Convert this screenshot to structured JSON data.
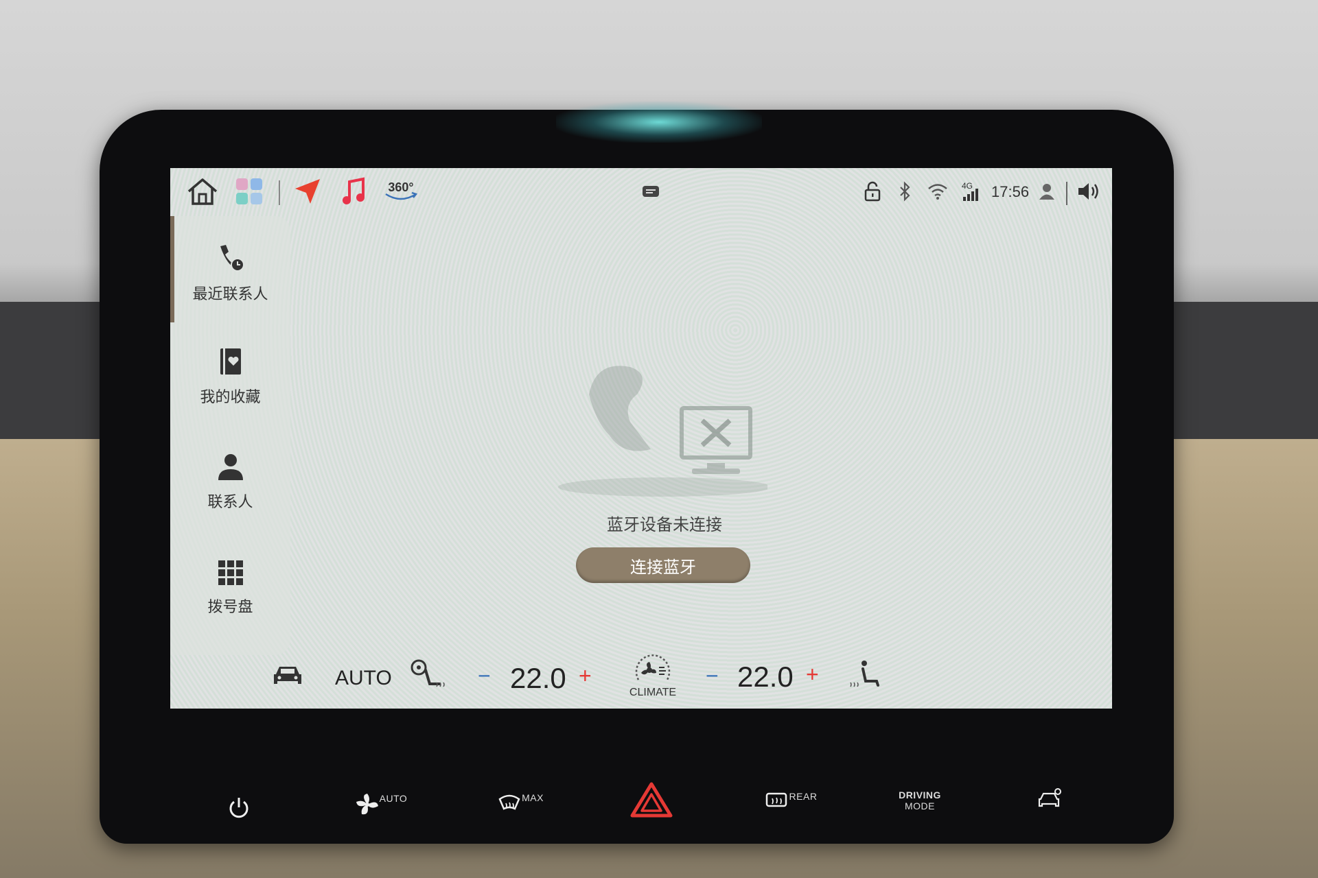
{
  "topbar": {
    "temp_icon_label": "360°",
    "time": "17:56",
    "network": "4G"
  },
  "sidebar": {
    "items": [
      {
        "label": "最近联系人",
        "icon": "phone-clock-icon"
      },
      {
        "label": "我的收藏",
        "icon": "favorites-book-icon"
      },
      {
        "label": "联系人",
        "icon": "person-icon"
      },
      {
        "label": "拨号盘",
        "icon": "dialpad-icon"
      }
    ]
  },
  "main": {
    "status_message": "蓝牙设备未连接",
    "connect_button_label": "连接蓝牙"
  },
  "climate": {
    "auto_label": "AUTO",
    "driver_minus": "−",
    "driver_temp": "22.0",
    "driver_plus": "+",
    "climate_label": "CLIMATE",
    "passenger_minus": "−",
    "passenger_temp": "22.0",
    "passenger_plus": "+"
  },
  "hardware": {
    "fan_auto": "AUTO",
    "defrost_max": "MAX",
    "rear_defrost": "REAR",
    "driving_mode_1": "DRIVING",
    "driving_mode_2": "MODE"
  },
  "colors": {
    "accent_red": "#e53935",
    "button_brown": "#8e7f6a",
    "nav_red": "#e8412f",
    "music_red": "#e8334a"
  }
}
